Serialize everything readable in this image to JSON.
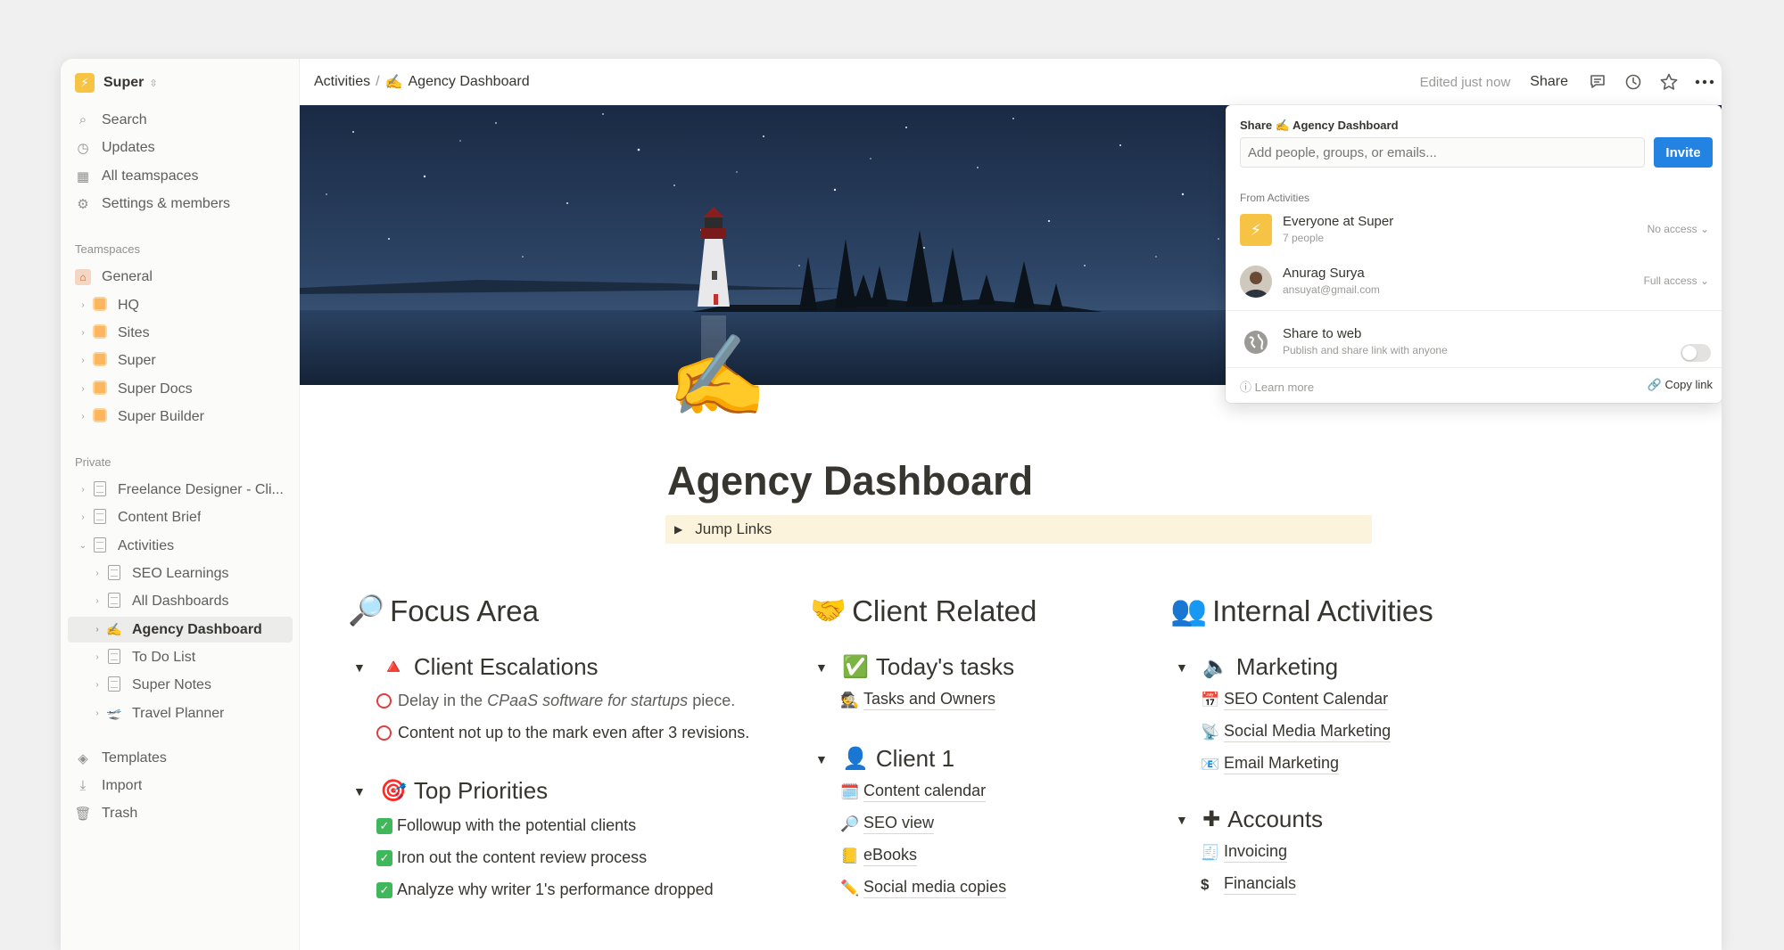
{
  "workspace": {
    "name": "Super"
  },
  "sidebar": {
    "top": [
      {
        "label": "Search",
        "icon": "search-icon"
      },
      {
        "label": "Updates",
        "icon": "clock-icon"
      },
      {
        "label": "All teamspaces",
        "icon": "building-icon"
      },
      {
        "label": "Settings & members",
        "icon": "gear-icon"
      }
    ],
    "teamspaces_heading": "Teamspaces",
    "teamspaces": [
      {
        "label": "General"
      },
      {
        "label": "HQ"
      },
      {
        "label": "Sites"
      },
      {
        "label": "Super"
      },
      {
        "label": "Super Docs"
      },
      {
        "label": "Super Builder"
      }
    ],
    "private_heading": "Private",
    "private": [
      {
        "label": "Freelance Designer - Cli..."
      },
      {
        "label": "Content Brief"
      },
      {
        "label": "Activities"
      },
      {
        "label": "SEO Learnings"
      },
      {
        "label": "All Dashboards"
      },
      {
        "label": "Agency Dashboard"
      },
      {
        "label": "To Do List"
      },
      {
        "label": "Super Notes"
      },
      {
        "label": "Travel Planner"
      }
    ],
    "bottom": [
      {
        "label": "Templates"
      },
      {
        "label": "Import"
      },
      {
        "label": "Trash"
      }
    ]
  },
  "topbar": {
    "breadcrumb_parent": "Activities",
    "breadcrumb_sep": "/",
    "breadcrumb_current": "Agency Dashboard",
    "edited": "Edited just now",
    "share": "Share"
  },
  "page": {
    "title": "Agency Dashboard",
    "jump_links": "Jump Links"
  },
  "columns": {
    "focus": {
      "heading": "Focus Area",
      "escalations_heading": "Client Escalations",
      "escalation_1_pre": "Delay in the",
      "escalation_1_italic": "CPaaS software for startups",
      "escalation_1_post": "piece.",
      "escalation_2": "Content not up to the mark even after 3 revisions.",
      "priorities_heading": "Top Priorities",
      "priorities": [
        "Followup with the potential clients",
        "Iron out the content review process",
        "Analyze why writer 1's performance dropped"
      ]
    },
    "client": {
      "heading": "Client Related",
      "tasks_heading": "Today's tasks",
      "tasks_link": "Tasks and Owners",
      "client1_heading": "Client 1",
      "client1_links": [
        "Content calendar",
        "SEO view",
        "eBooks",
        "Social media copies"
      ]
    },
    "internal": {
      "heading": "Internal Activities",
      "marketing_heading": "Marketing",
      "marketing_links": [
        "SEO Content Calendar",
        "Social Media Marketing",
        "Email Marketing"
      ],
      "accounts_heading": "Accounts",
      "accounts_links": [
        "Invoicing",
        "Financials"
      ]
    }
  },
  "share_popup": {
    "title": "Share ✍️ Agency Dashboard",
    "placeholder": "Add people, groups, or emails...",
    "invite": "Invite",
    "from": "From Activities",
    "everyone_name": "Everyone at Super",
    "everyone_sub": "7 people",
    "everyone_access": "No access",
    "user_name": "Anurag Surya",
    "user_email": "ansuyat@gmail.com",
    "user_access": "Full access",
    "web_title": "Share to web",
    "web_sub": "Publish and share link with anyone",
    "learn_more": "Learn more",
    "copy_link": "Copy link"
  }
}
